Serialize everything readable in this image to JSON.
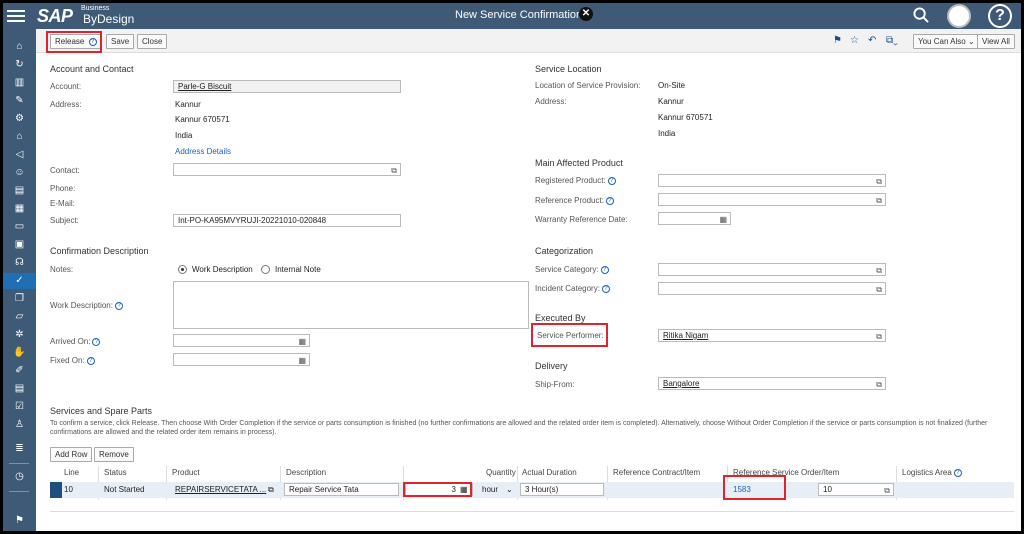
{
  "header": {
    "logo_main": "SAP",
    "logo_sub": "Business",
    "logo_product": "ByDesign",
    "title": "New Service Confirmation"
  },
  "sidebar": {
    "icons": [
      "home-icon",
      "refresh-icon",
      "chart-icon",
      "tools-icon",
      "gear-icon",
      "building-icon",
      "megaphone-icon",
      "person-icon",
      "document-icon",
      "report-icon",
      "id-card-icon",
      "clipboard-icon",
      "headset-icon",
      "clipboard-check-icon",
      "stack-icon",
      "inbox-icon",
      "gears-icon",
      "hand-icon",
      "edit-icon",
      "list-doc-icon",
      "check-doc-icon",
      "user-icon",
      "list-icon",
      "clock-icon",
      "flag-icon"
    ]
  },
  "toolbar": {
    "release": "Release",
    "save": "Save",
    "close": "Close",
    "you_can_also": "You Can Also",
    "view_all": "View All"
  },
  "account_contact": {
    "title": "Account and Contact",
    "account_label": "Account:",
    "account_value": "Parle-G Biscuit",
    "address_label": "Address:",
    "address_line1": "Kannur",
    "address_line2": "Kannur 670571",
    "address_line3": "India",
    "address_details": "Address Details",
    "contact_label": "Contact:",
    "phone_label": "Phone:",
    "email_label": "E-Mail:",
    "subject_label": "Subject:",
    "subject_value": "Int-PO-KA95MVYRUJI-20221010-020848"
  },
  "confirmation": {
    "title": "Confirmation Description",
    "notes_label": "Notes:",
    "radio_work": "Work Description",
    "radio_internal": "Internal Note",
    "work_desc_label": "Work Description:",
    "arrived_label": "Arrived On:",
    "fixed_label": "Fixed On:"
  },
  "service_location": {
    "title": "Service Location",
    "location_label": "Location of Service Provision:",
    "location_value": "On-Site",
    "address_label": "Address:",
    "address_line1": "Kannur",
    "address_line2": "Kannur 670571",
    "address_line3": "India"
  },
  "main_product": {
    "title": "Main Affected Product",
    "registered_label": "Registered Product:",
    "reference_label": "Reference Product:",
    "warranty_label": "Warranty Reference Date:"
  },
  "categorization": {
    "title": "Categorization",
    "service_cat_label": "Service Category:",
    "incident_cat_label": "Incident Category:"
  },
  "executed_by": {
    "title": "Executed By",
    "performer_label": "Service Performer:",
    "performer_value": "Ritika Nigam"
  },
  "delivery": {
    "title": "Delivery",
    "ship_from_label": "Ship-From:",
    "ship_from_value": "Bangalore"
  },
  "services": {
    "title": "Services and Spare Parts",
    "note": "To confirm a service, click Release. Then choose With Order Completion if the service or parts consumption is finished (no further confirmations are allowed and the related order item is completed). Alternatively, choose Without Order Completion if the service or parts consumption is not finalized (further confirmations are allowed and the related order item remains in process).",
    "add_row": "Add Row",
    "remove": "Remove",
    "columns": {
      "line": "Line",
      "status": "Status",
      "product": "Product",
      "description": "Description",
      "quantity": "Quantity",
      "actual_duration": "Actual Duration",
      "ref_contract": "Reference Contract/Item",
      "ref_order": "Reference Service Order/Item",
      "logistics": "Logistics Area"
    },
    "row": {
      "line": "10",
      "status": "Not Started",
      "product": "REPAIRSERVICETATA ...",
      "description": "Repair Service Tata",
      "quantity": "3",
      "unit": "hour",
      "actual_duration": "3 Hour(s)",
      "ref_order": "1583",
      "ref_item": "10"
    }
  },
  "colors": {
    "shell": "#3e5a76",
    "highlight": "#e0232d",
    "link": "#1764b4"
  }
}
